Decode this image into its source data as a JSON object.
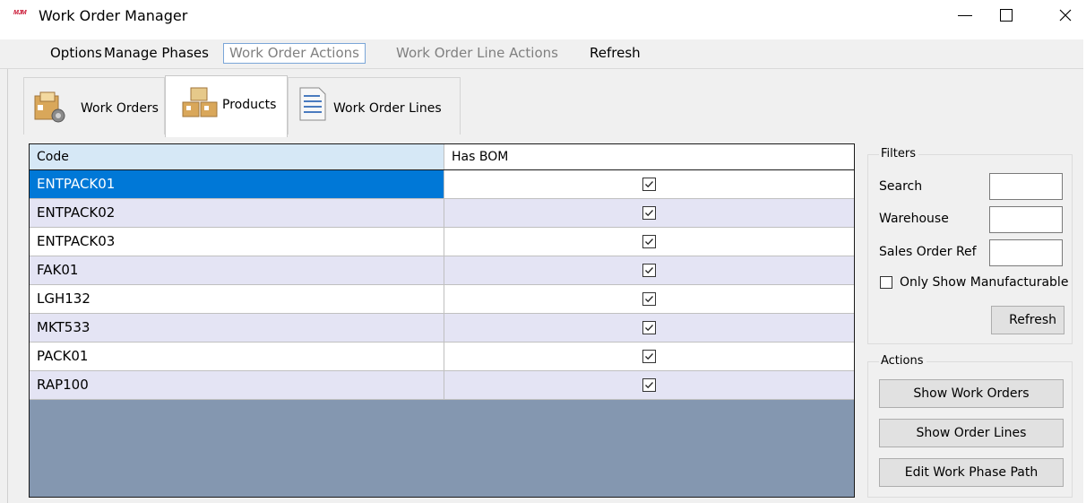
{
  "window": {
    "logo_text": "MJM",
    "title": "Work Order Manager",
    "minimize_glyph": "—",
    "maximize_glyph": "☐",
    "close_glyph": "✕"
  },
  "menu": {
    "options": "Options",
    "manage_phases": "Manage Phases",
    "work_order_actions": "Work Order Actions",
    "work_order_line_actions": "Work Order Line Actions",
    "refresh": "Refresh"
  },
  "tabs": [
    {
      "label": "Work Orders",
      "icon": "work-orders-icon",
      "selected": false
    },
    {
      "label": "Products",
      "icon": "products-icon",
      "selected": true
    },
    {
      "label": "Work Order Lines",
      "icon": "document-icon",
      "selected": false
    }
  ],
  "grid": {
    "columns": [
      "Code",
      "Has BOM"
    ],
    "rows": [
      {
        "code": "ENTPACK01",
        "has_bom": true,
        "selected": true
      },
      {
        "code": "ENTPACK02",
        "has_bom": true
      },
      {
        "code": "ENTPACK03",
        "has_bom": true
      },
      {
        "code": "FAK01",
        "has_bom": true
      },
      {
        "code": "LGH132",
        "has_bom": true
      },
      {
        "code": "MKT533",
        "has_bom": true
      },
      {
        "code": "PACK01",
        "has_bom": true
      },
      {
        "code": "RAP100",
        "has_bom": true
      }
    ]
  },
  "filters": {
    "title": "Filters",
    "search_label": "Search",
    "search_value": "",
    "warehouse_label": "Warehouse",
    "warehouse_value": "",
    "sales_order_ref_label": "Sales Order Ref",
    "sales_order_ref_value": "",
    "only_manufacturable_label": "Only Show Manufacturable",
    "only_manufacturable_checked": false,
    "refresh_button": "Refresh"
  },
  "actions": {
    "title": "Actions",
    "show_work_orders": "Show Work Orders",
    "show_order_lines": "Show Order Lines",
    "edit_work_phase_path": "Edit Work Phase Path"
  },
  "colors": {
    "selected_row": "#0078d7",
    "alt_row": "#e4e4f4",
    "header_selected": "#d6e8f6",
    "grid_empty": "#8497b0"
  }
}
